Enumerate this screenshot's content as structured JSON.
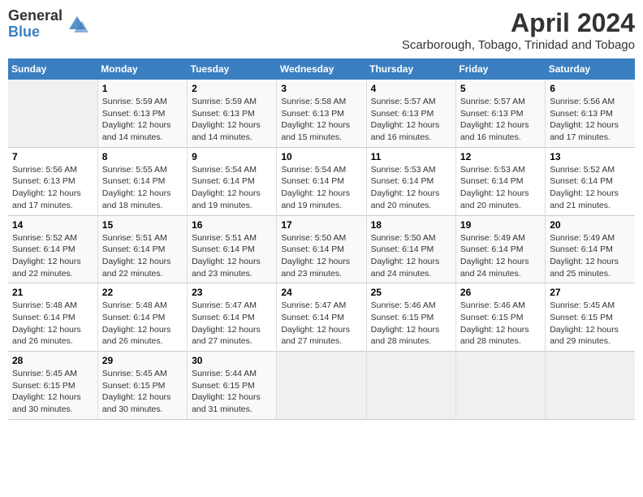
{
  "logo": {
    "general": "General",
    "blue": "Blue"
  },
  "title": "April 2024",
  "location": "Scarborough, Tobago, Trinidad and Tobago",
  "days_of_week": [
    "Sunday",
    "Monday",
    "Tuesday",
    "Wednesday",
    "Thursday",
    "Friday",
    "Saturday"
  ],
  "weeks": [
    [
      {
        "day": "",
        "empty": true
      },
      {
        "day": "1",
        "sunrise": "Sunrise: 5:59 AM",
        "sunset": "Sunset: 6:13 PM",
        "daylight": "Daylight: 12 hours and 14 minutes."
      },
      {
        "day": "2",
        "sunrise": "Sunrise: 5:59 AM",
        "sunset": "Sunset: 6:13 PM",
        "daylight": "Daylight: 12 hours and 14 minutes."
      },
      {
        "day": "3",
        "sunrise": "Sunrise: 5:58 AM",
        "sunset": "Sunset: 6:13 PM",
        "daylight": "Daylight: 12 hours and 15 minutes."
      },
      {
        "day": "4",
        "sunrise": "Sunrise: 5:57 AM",
        "sunset": "Sunset: 6:13 PM",
        "daylight": "Daylight: 12 hours and 16 minutes."
      },
      {
        "day": "5",
        "sunrise": "Sunrise: 5:57 AM",
        "sunset": "Sunset: 6:13 PM",
        "daylight": "Daylight: 12 hours and 16 minutes."
      },
      {
        "day": "6",
        "sunrise": "Sunrise: 5:56 AM",
        "sunset": "Sunset: 6:13 PM",
        "daylight": "Daylight: 12 hours and 17 minutes."
      }
    ],
    [
      {
        "day": "7",
        "sunrise": "Sunrise: 5:56 AM",
        "sunset": "Sunset: 6:13 PM",
        "daylight": "Daylight: 12 hours and 17 minutes."
      },
      {
        "day": "8",
        "sunrise": "Sunrise: 5:55 AM",
        "sunset": "Sunset: 6:14 PM",
        "daylight": "Daylight: 12 hours and 18 minutes."
      },
      {
        "day": "9",
        "sunrise": "Sunrise: 5:54 AM",
        "sunset": "Sunset: 6:14 PM",
        "daylight": "Daylight: 12 hours and 19 minutes."
      },
      {
        "day": "10",
        "sunrise": "Sunrise: 5:54 AM",
        "sunset": "Sunset: 6:14 PM",
        "daylight": "Daylight: 12 hours and 19 minutes."
      },
      {
        "day": "11",
        "sunrise": "Sunrise: 5:53 AM",
        "sunset": "Sunset: 6:14 PM",
        "daylight": "Daylight: 12 hours and 20 minutes."
      },
      {
        "day": "12",
        "sunrise": "Sunrise: 5:53 AM",
        "sunset": "Sunset: 6:14 PM",
        "daylight": "Daylight: 12 hours and 20 minutes."
      },
      {
        "day": "13",
        "sunrise": "Sunrise: 5:52 AM",
        "sunset": "Sunset: 6:14 PM",
        "daylight": "Daylight: 12 hours and 21 minutes."
      }
    ],
    [
      {
        "day": "14",
        "sunrise": "Sunrise: 5:52 AM",
        "sunset": "Sunset: 6:14 PM",
        "daylight": "Daylight: 12 hours and 22 minutes."
      },
      {
        "day": "15",
        "sunrise": "Sunrise: 5:51 AM",
        "sunset": "Sunset: 6:14 PM",
        "daylight": "Daylight: 12 hours and 22 minutes."
      },
      {
        "day": "16",
        "sunrise": "Sunrise: 5:51 AM",
        "sunset": "Sunset: 6:14 PM",
        "daylight": "Daylight: 12 hours and 23 minutes."
      },
      {
        "day": "17",
        "sunrise": "Sunrise: 5:50 AM",
        "sunset": "Sunset: 6:14 PM",
        "daylight": "Daylight: 12 hours and 23 minutes."
      },
      {
        "day": "18",
        "sunrise": "Sunrise: 5:50 AM",
        "sunset": "Sunset: 6:14 PM",
        "daylight": "Daylight: 12 hours and 24 minutes."
      },
      {
        "day": "19",
        "sunrise": "Sunrise: 5:49 AM",
        "sunset": "Sunset: 6:14 PM",
        "daylight": "Daylight: 12 hours and 24 minutes."
      },
      {
        "day": "20",
        "sunrise": "Sunrise: 5:49 AM",
        "sunset": "Sunset: 6:14 PM",
        "daylight": "Daylight: 12 hours and 25 minutes."
      }
    ],
    [
      {
        "day": "21",
        "sunrise": "Sunrise: 5:48 AM",
        "sunset": "Sunset: 6:14 PM",
        "daylight": "Daylight: 12 hours and 26 minutes."
      },
      {
        "day": "22",
        "sunrise": "Sunrise: 5:48 AM",
        "sunset": "Sunset: 6:14 PM",
        "daylight": "Daylight: 12 hours and 26 minutes."
      },
      {
        "day": "23",
        "sunrise": "Sunrise: 5:47 AM",
        "sunset": "Sunset: 6:14 PM",
        "daylight": "Daylight: 12 hours and 27 minutes."
      },
      {
        "day": "24",
        "sunrise": "Sunrise: 5:47 AM",
        "sunset": "Sunset: 6:14 PM",
        "daylight": "Daylight: 12 hours and 27 minutes."
      },
      {
        "day": "25",
        "sunrise": "Sunrise: 5:46 AM",
        "sunset": "Sunset: 6:15 PM",
        "daylight": "Daylight: 12 hours and 28 minutes."
      },
      {
        "day": "26",
        "sunrise": "Sunrise: 5:46 AM",
        "sunset": "Sunset: 6:15 PM",
        "daylight": "Daylight: 12 hours and 28 minutes."
      },
      {
        "day": "27",
        "sunrise": "Sunrise: 5:45 AM",
        "sunset": "Sunset: 6:15 PM",
        "daylight": "Daylight: 12 hours and 29 minutes."
      }
    ],
    [
      {
        "day": "28",
        "sunrise": "Sunrise: 5:45 AM",
        "sunset": "Sunset: 6:15 PM",
        "daylight": "Daylight: 12 hours and 30 minutes."
      },
      {
        "day": "29",
        "sunrise": "Sunrise: 5:45 AM",
        "sunset": "Sunset: 6:15 PM",
        "daylight": "Daylight: 12 hours and 30 minutes."
      },
      {
        "day": "30",
        "sunrise": "Sunrise: 5:44 AM",
        "sunset": "Sunset: 6:15 PM",
        "daylight": "Daylight: 12 hours and 31 minutes."
      },
      {
        "day": "",
        "empty": true
      },
      {
        "day": "",
        "empty": true
      },
      {
        "day": "",
        "empty": true
      },
      {
        "day": "",
        "empty": true
      }
    ]
  ]
}
